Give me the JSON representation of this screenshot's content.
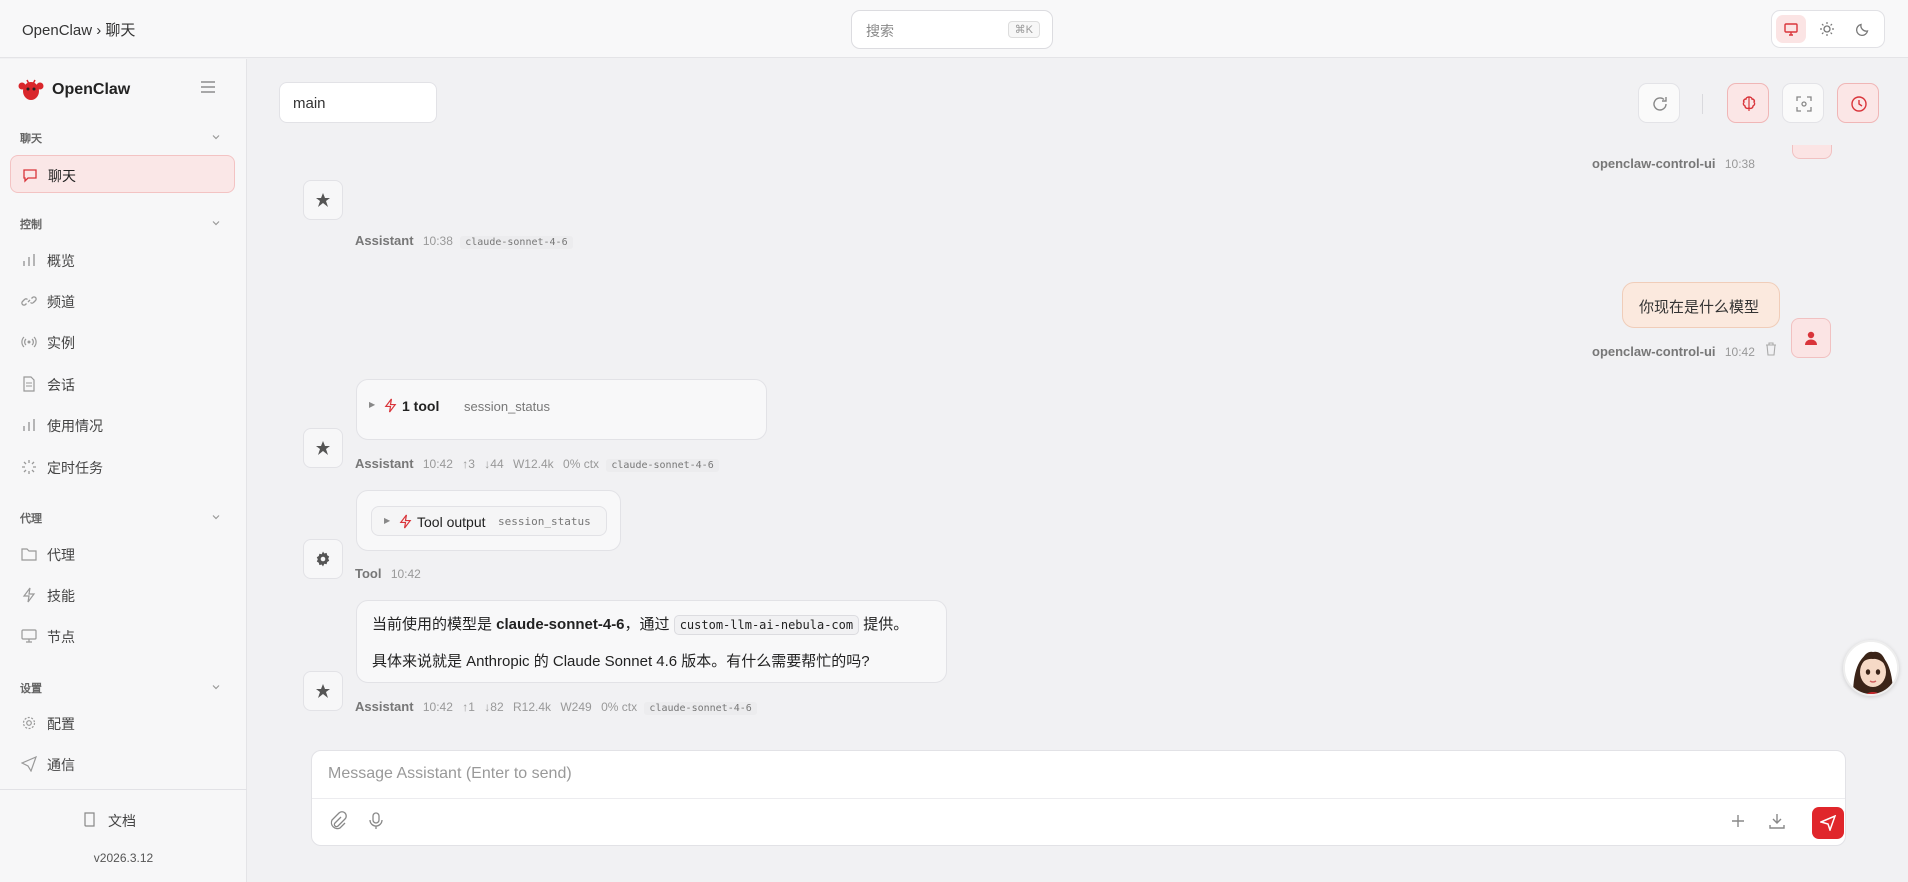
{
  "topbar": {
    "breadcrumb": "OpenClaw › 聊天",
    "search_label": "搜索",
    "search_shortcut": "⌘K",
    "theme_modes": [
      "system-icon",
      "sun-icon",
      "moon-icon"
    ]
  },
  "sidebar": {
    "brand": "OpenClaw",
    "sections": {
      "chat": "聊天",
      "control": "控制",
      "agent": "代理",
      "settings": "设置"
    },
    "items": {
      "chat": "聊天",
      "overview": "概览",
      "channels": "频道",
      "instances": "实例",
      "sessions": "会话",
      "usage": "使用情况",
      "cron": "定时任务",
      "agents": "代理",
      "skills": "技能",
      "nodes": "节点",
      "config": "配置",
      "comms": "通信"
    },
    "docs": "文档",
    "version": "v2026.3.12"
  },
  "main": {
    "session": "main"
  },
  "messages": {
    "m0_user": "openclaw-control-ui",
    "m0_time": "10:38",
    "m1_who": "Assistant",
    "m1_time": "10:38",
    "m1_model": "claude-sonnet-4-6",
    "m2_text": "你现在是什么模型",
    "m2_user": "openclaw-control-ui",
    "m2_time": "10:42",
    "m3_tool_count": "1 tool",
    "m3_tool_name": "session_status",
    "m3_who": "Assistant",
    "m3_time": "10:42",
    "m3_up": "↑3",
    "m3_down": "↓44",
    "m3_w": "W12.4k",
    "m3_ctx": "0% ctx",
    "m3_model": "claude-sonnet-4-6",
    "m4_tool_title": "Tool output",
    "m4_tool_name": "session_status",
    "m4_who": "Tool",
    "m4_time": "10:42",
    "m5_line1_a": "当前使用的模型是 ",
    "m5_line1_b": "claude-sonnet-4-6",
    "m5_line1_c": "，通过 ",
    "m5_line1_code": "custom-llm-ai-nebula-com",
    "m5_line1_d": " 提供。",
    "m5_line2": "具体来说就是 Anthropic 的 Claude Sonnet 4.6 版本。有什么需要帮忙的吗?",
    "m5_who": "Assistant",
    "m5_time": "10:42",
    "m5_up": "↑1",
    "m5_down": "↓82",
    "m5_r": "R12.4k",
    "m5_w": "W249",
    "m5_ctx": "0% ctx",
    "m5_model": "claude-sonnet-4-6"
  },
  "composer": {
    "placeholder": "Message Assistant (Enter to send)"
  },
  "colors": {
    "accent": "#e0262b",
    "accent_soft": "#fbe4e4",
    "user_bubble": "#fbe9de"
  }
}
